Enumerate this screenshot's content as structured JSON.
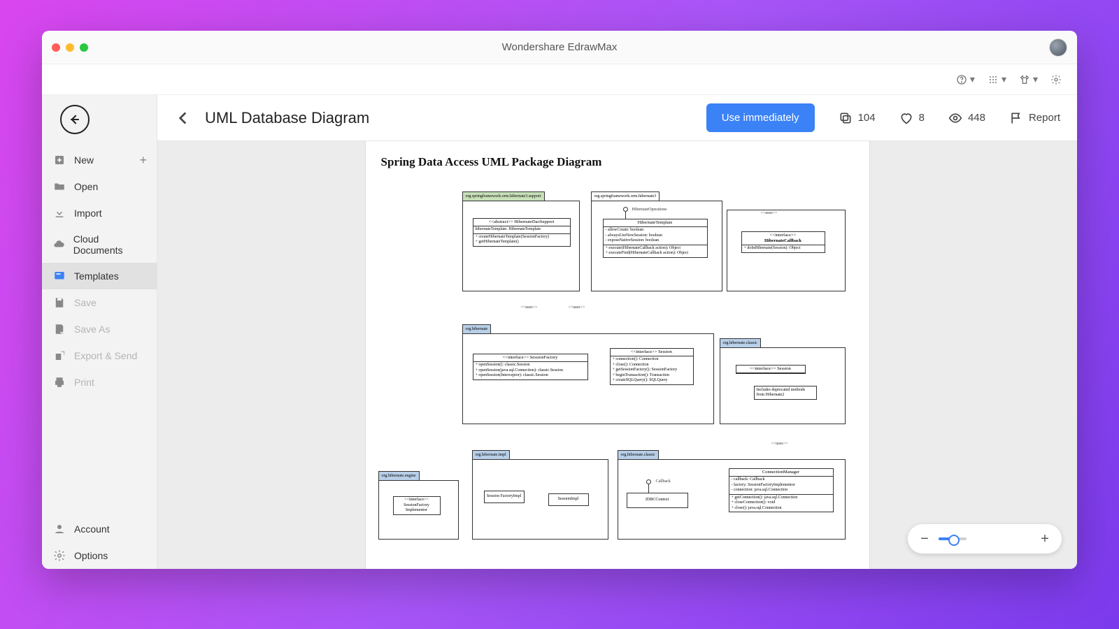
{
  "window": {
    "title": "Wondershare EdrawMax"
  },
  "sidebar": {
    "items": [
      {
        "label": "New"
      },
      {
        "label": "Open"
      },
      {
        "label": "Import"
      },
      {
        "label": "Cloud Documents"
      },
      {
        "label": "Templates"
      },
      {
        "label": "Save"
      },
      {
        "label": "Save As"
      },
      {
        "label": "Export & Send"
      },
      {
        "label": "Print"
      }
    ],
    "bottom": [
      {
        "label": "Account"
      },
      {
        "label": "Options"
      }
    ]
  },
  "header": {
    "title": "UML Database Diagram",
    "use_button": "Use immediately",
    "copies": "104",
    "likes": "8",
    "views": "448",
    "report": "Report"
  },
  "diagram": {
    "title": "Spring Data Access UML Package Diagram",
    "pkg1_tab": "org.springframework.orm.hibernate3.support",
    "pkg2_tab": "org.springframework.orm.hibernate3",
    "pkg3_tab": "org.hibernate",
    "pkg4_tab": "org.hibernate.classic",
    "pkg5_tab": "org.hibernate.impl",
    "pkg6_tab": "org.hibernate.engine",
    "pkg7_tab": "org.hibernate.classic",
    "cls1_h": "<<abstract>> HibernateDaoSupport",
    "cls1_a": "hibernateTemplate: HibernateTemplate",
    "cls1_m1": "+ createHibernateTemplate(SessionFactory)",
    "cls1_m2": "+ getHibernateTemplate()",
    "ho_label": "HibernateOperations",
    "ht_h": "HibernateTemplate",
    "ht_a1": "- allowCreate: boolean",
    "ht_a2": "- alwaysUseNewSession: boolean",
    "ht_a3": "- exposeNativeSession: boolean",
    "ht_m1": "+ execute(HibernateCallback action): Object",
    "ht_m2": "+ executeFind(HibernateCallback action): Object",
    "hc_h1": "<<interface>>",
    "hc_h2": "HibernateCallback",
    "hc_m": "+ doInHibernate(Session): Object",
    "sf_h": "<<interface>> SessionFactory",
    "sf_m1": "+ openSession(): classic.Session",
    "sf_m2": "+ openSession(java.sql.Connection): classic.Session",
    "sf_m3": "+ openSession(Interceptor): classic.Session",
    "ses_h": "<<interface>> Session",
    "ses_m1": "+ connection(): Connection",
    "ses_m2": "+ close(): Connection",
    "ses_m3": "+ getSessionFactory(): SessionFactory",
    "ses_m4": "+ beginTransaction(): Transaction",
    "ses_m5": "+ createSQLQuery(): SQLQuery",
    "cses_h": "<<interface>> Session",
    "cses_note": "Includes deprecated methods from Hibernate2",
    "sfimpl_h": "Session FactoryImpl",
    "simpl_h": "SessionImpl",
    "jdbc_h": "JDBCContext",
    "cb_label": "Callback",
    "cm_h": "ConnectionManager",
    "cm_a1": "- callback: Callback",
    "cm_a2": "- factory: SessionFactoryImplementor",
    "cm_a3": "- connection: java.sql.Connection",
    "cm_m1": "+ getConnection(): java.sql.Connection",
    "cm_m2": "+ closeConnection(): void",
    "cm_m3": "+ close(): java.sql.Connection",
    "eng_h1": "<<interface>>",
    "eng_h2": "SessionFactory",
    "eng_h3": "Implementor",
    "uses": "<<uses>>"
  }
}
